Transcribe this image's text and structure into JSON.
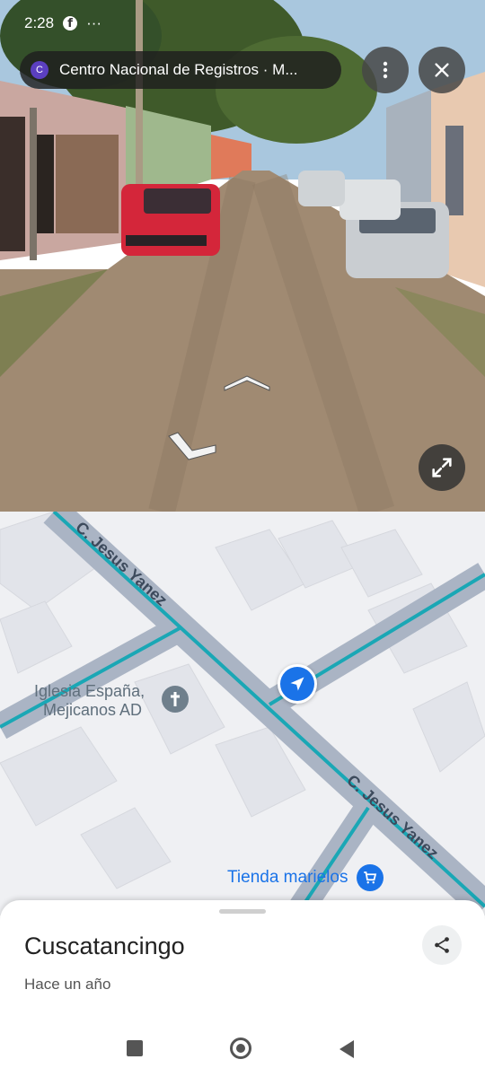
{
  "status_bar": {
    "time": "2:28",
    "app_icon": "facebook-icon",
    "more_glyph": "···"
  },
  "header": {
    "place_badge": "C",
    "title": "Centro Nacional de Registros · M...",
    "menu_icon": "vertical-dots-icon",
    "close_icon": "close-icon"
  },
  "streetview": {
    "expand_icon": "expand-icon",
    "nav_arrows": [
      "chevron-up-icon",
      "chevron-down-left-icon"
    ]
  },
  "map": {
    "street_labels": [
      "C. Jesus Yanez",
      "C. Jesus Yanez"
    ],
    "poi_church": {
      "line1": "Iglesia España,",
      "line2": "Mejicanos AD",
      "icon": "cross-icon"
    },
    "poi_store": {
      "label": "Tienda marielos",
      "icon": "cart-icon"
    },
    "location_icon": "navigation-arrow-icon"
  },
  "bottom_sheet": {
    "title": "Cuscatancingo",
    "subtitle": "Hace un año",
    "share_icon": "share-icon"
  },
  "nav": {
    "recents": "square-icon",
    "home": "circle-icon",
    "back": "triangle-back-icon"
  },
  "colors": {
    "route": "#1aa7b5",
    "poi_blue": "#1a73e8",
    "church_grey": "#5f6f7c"
  }
}
